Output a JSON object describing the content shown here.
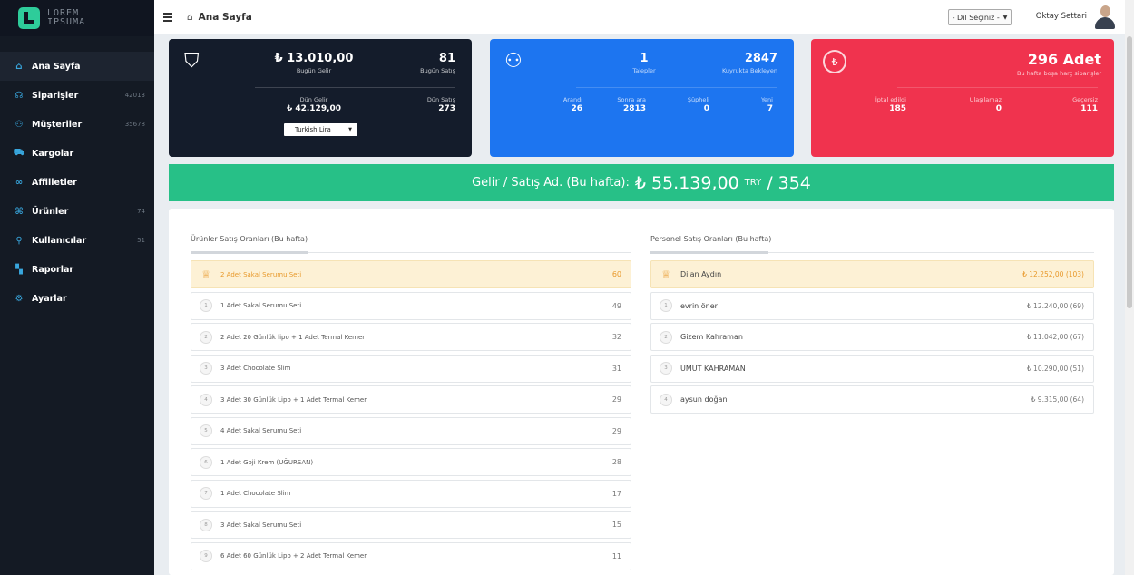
{
  "brand": {
    "line1": "LOREM",
    "line2": "IPSUMA"
  },
  "sidebar": {
    "items": [
      {
        "label": "Ana Sayfa",
        "icon": "home-icon",
        "glyph": "⌂",
        "count": ""
      },
      {
        "label": "Siparişler",
        "icon": "headset-icon",
        "glyph": "☊",
        "count": "42013"
      },
      {
        "label": "Müşteriler",
        "icon": "users-icon",
        "glyph": "⚇",
        "count": "35678"
      },
      {
        "label": "Kargolar",
        "icon": "truck-icon",
        "glyph": "⛟",
        "count": ""
      },
      {
        "label": "Affilietler",
        "icon": "link-icon",
        "glyph": "∞",
        "count": ""
      },
      {
        "label": "Ürünler",
        "icon": "gift-icon",
        "glyph": "⌘",
        "count": "74"
      },
      {
        "label": "Kullanıcılar",
        "icon": "user-icon",
        "glyph": "⚲",
        "count": "51"
      },
      {
        "label": "Raporlar",
        "icon": "chart-icon",
        "glyph": "▚",
        "count": ""
      },
      {
        "label": "Ayarlar",
        "icon": "gear-icon",
        "glyph": "⚙",
        "count": ""
      }
    ]
  },
  "header": {
    "title": "Ana Sayfa",
    "lang_select": "- Dil Seçiniz -",
    "user_name": "Oktay Settari"
  },
  "card1": {
    "income": "₺ 13.010,00",
    "income_label": "Bugün Gelir",
    "sales": "81",
    "sales_label": "Bugün Satış",
    "yday_income_label": "Dün Gelir",
    "yday_income": "₺ 42.129,00",
    "yday_sales_label": "Dün Satış",
    "yday_sales": "273",
    "currency": "Turkish Lira"
  },
  "card2": {
    "requests": "1",
    "requests_label": "Talepler",
    "queue": "2847",
    "queue_label": "Kuyrukta Bekleyen",
    "stats": [
      {
        "label": "Arandı",
        "value": "26"
      },
      {
        "label": "Sonra ara",
        "value": "2813"
      },
      {
        "label": "Şüpheli",
        "value": "0"
      },
      {
        "label": "Yeni",
        "value": "7"
      }
    ]
  },
  "card3": {
    "count": "296 Adet",
    "count_label": "Bu hafta boşa harç siparişler",
    "stats": [
      {
        "label": "İptal edildi",
        "value": "185"
      },
      {
        "label": "Ulaşılamaz",
        "value": "0"
      },
      {
        "label": "Geçersiz",
        "value": "111"
      }
    ]
  },
  "banner": {
    "label": "Gelir / Satış Ad. (Bu hafta):",
    "amount": "₺ 55.139,00",
    "currency": "TRY",
    "separator": "/",
    "count": "354"
  },
  "products": {
    "title": "Ürünler Satış Oranları (Bu hafta)",
    "rows": [
      {
        "rank": "",
        "name": "2 Adet Sakal Serumu Seti",
        "value": "60"
      },
      {
        "rank": "1",
        "name": "1 Adet Sakal Serumu Seti",
        "value": "49"
      },
      {
        "rank": "2",
        "name": "2 Adet 20 Günlük lipo + 1 Adet Termal Kemer",
        "value": "32"
      },
      {
        "rank": "3",
        "name": "3 Adet Chocolate Slim",
        "value": "31"
      },
      {
        "rank": "4",
        "name": "3 Adet 30 Günlük Lipo + 1 Adet Termal Kemer",
        "value": "29"
      },
      {
        "rank": "5",
        "name": "4 Adet Sakal Serumu Seti",
        "value": "29"
      },
      {
        "rank": "6",
        "name": "1 Adet Goji Krem (UĞURSAN)",
        "value": "28"
      },
      {
        "rank": "7",
        "name": "1 Adet Chocolate Slim",
        "value": "17"
      },
      {
        "rank": "8",
        "name": "3 Adet Sakal Serumu Seti",
        "value": "15"
      },
      {
        "rank": "9",
        "name": "6 Adet 60 Günlük Lipo + 2 Adet Termal Kemer",
        "value": "11"
      }
    ]
  },
  "staff": {
    "title": "Personel Satış Oranları (Bu hafta)",
    "rows": [
      {
        "rank": "",
        "name": "Dilan Aydın",
        "value": "₺ 12.252,00 (103)"
      },
      {
        "rank": "1",
        "name": "evrin öner",
        "value": "₺ 12.240,00 (69)"
      },
      {
        "rank": "2",
        "name": "Gizem Kahraman",
        "value": "₺ 11.042,00 (67)"
      },
      {
        "rank": "3",
        "name": "UMUT KAHRAMAN",
        "value": "₺ 10.290,00 (51)"
      },
      {
        "rank": "4",
        "name": "aysun doğan",
        "value": "₺ 9.315,00 (64)"
      }
    ]
  },
  "colors": {
    "sidebar": "#141a24",
    "card1": "#141c2b",
    "card2": "#1d75f0",
    "card3": "#f0334e",
    "banner": "#27c087",
    "highlight": "#fdf1d5"
  }
}
